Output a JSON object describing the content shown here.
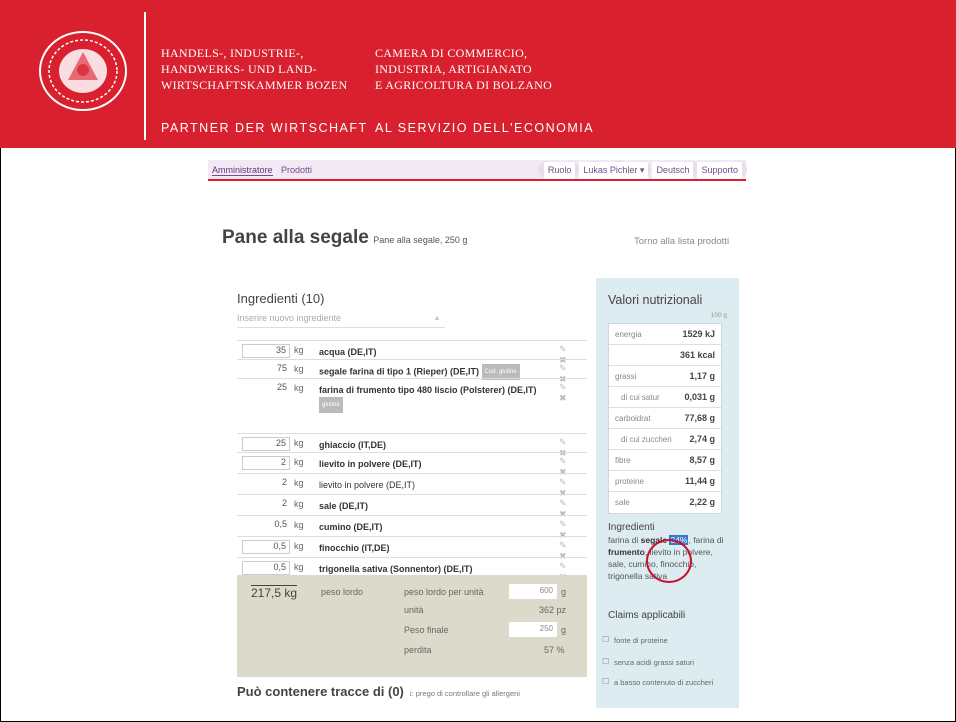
{
  "header": {
    "org_de": [
      "HANDELS-, INDUSTRIE-,",
      "HANDWERKS- UND LAND-",
      "WIRTSCHAFTSKAMMER BOZEN"
    ],
    "org_it": [
      "CAMERA DI COMMERCIO,",
      "INDUSTRIA, ARTIGIANATO",
      "E AGRICOLTURA DI BOLZANO"
    ],
    "tagline_de": "PARTNER DER WIRTSCHAFT",
    "tagline_it": "AL SERVIZIO DELL'ECONOMIA",
    "bg_color": "#d9202e"
  },
  "nav": {
    "left": [
      "Amministratore",
      "Prodotti"
    ],
    "right": [
      "Ruolo",
      "Lukas Pichler ▾",
      "Deutsch",
      "Supporto"
    ]
  },
  "product": {
    "title": "Pane alla segale",
    "subtitle": "Pane alla segale, 250 g",
    "back_link": "Torno alla lista prodotti"
  },
  "ingredients": {
    "heading": "Ingredienti (10)",
    "placeholder": "Inserire nuovo ingrediente",
    "rows": [
      {
        "qty": "35",
        "unit": "kg",
        "name": "acqua (DE,IT)",
        "badge": ""
      },
      {
        "qty": "75",
        "unit": "kg",
        "name": "segale farina di tipo 1 (Rieper) (DE,IT)",
        "badge": "Cod. glutine"
      },
      {
        "qty": "25",
        "unit": "kg",
        "name": "farina di frumento tipo 480 liscio (Polsterer) (DE,IT)",
        "badge": "glutine"
      },
      {
        "qty": "25",
        "unit": "kg",
        "name": "ghiaccio (IT,DE)",
        "badge": ""
      },
      {
        "qty": "2",
        "unit": "kg",
        "name": "lievito in polvere (DE,IT)",
        "badge": ""
      },
      {
        "qty": "2",
        "unit": "kg",
        "name": "lievito in polvere (DE,IT)",
        "badge": ""
      },
      {
        "qty": "2",
        "unit": "kg",
        "name": "sale (DE,IT)",
        "badge": ""
      },
      {
        "qty": "0,5",
        "unit": "kg",
        "name": "cumino (DE,IT)",
        "badge": ""
      },
      {
        "qty": "0,5",
        "unit": "kg",
        "name": "finocchio (IT,DE)",
        "badge": ""
      },
      {
        "qty": "0,5",
        "unit": "kg",
        "name": "trigonella sativa (Sonnentor) (DE,IT)",
        "badge": ""
      }
    ],
    "icons": "✎ ✖"
  },
  "summary": {
    "total": "217,5 kg",
    "gross_label": "peso lordo",
    "per_unit_label": "peso lordo per unità",
    "per_unit_value": "600",
    "per_unit_unit": "g",
    "units_label": "unità",
    "units_value": "362 pz",
    "net_label": "Peso finale",
    "net_value": "250",
    "net_unit": "g",
    "loss_label": "perdita",
    "loss_value": "57 %"
  },
  "traces": {
    "heading": "Può contenere tracce di (0)",
    "note": "i: prego di controllare gli allergeni"
  },
  "nutrition": {
    "heading": "Valori nutrizionali",
    "per": "100 g",
    "rows": [
      {
        "k": "energia",
        "v": "1529 kJ",
        "sub": false
      },
      {
        "k": "",
        "v": "361 kcal",
        "sub": false
      },
      {
        "k": "grassi",
        "v": "1,17 g",
        "sub": false
      },
      {
        "k": "di cui satur",
        "v": "0,031 g",
        "sub": true
      },
      {
        "k": "carboidrat",
        "v": "77,68 g",
        "sub": false
      },
      {
        "k": "di cui zuccheri",
        "v": "2,74 g",
        "sub": true
      },
      {
        "k": "fibre",
        "v": "8,57 g",
        "sub": false
      },
      {
        "k": "proteine",
        "v": "11,44 g",
        "sub": false
      },
      {
        "k": "sale",
        "v": "2,22 g",
        "sub": false
      }
    ],
    "ing_heading": "Ingredienti",
    "ing_pre": "farina di ",
    "ing_bold": "segale",
    "ing_hl": "34%",
    "ing_mid": ", farina di ",
    "ing_bold2": "frumento",
    "ing_post": ", lievito in polvere, sale, cumino, finocchio, trigonella sativa",
    "claims_heading": "Claims applicabili",
    "claims": [
      "fonte di proteine",
      "senza acidi grassi saturi",
      "a basso contenuto di zuccheri"
    ]
  }
}
